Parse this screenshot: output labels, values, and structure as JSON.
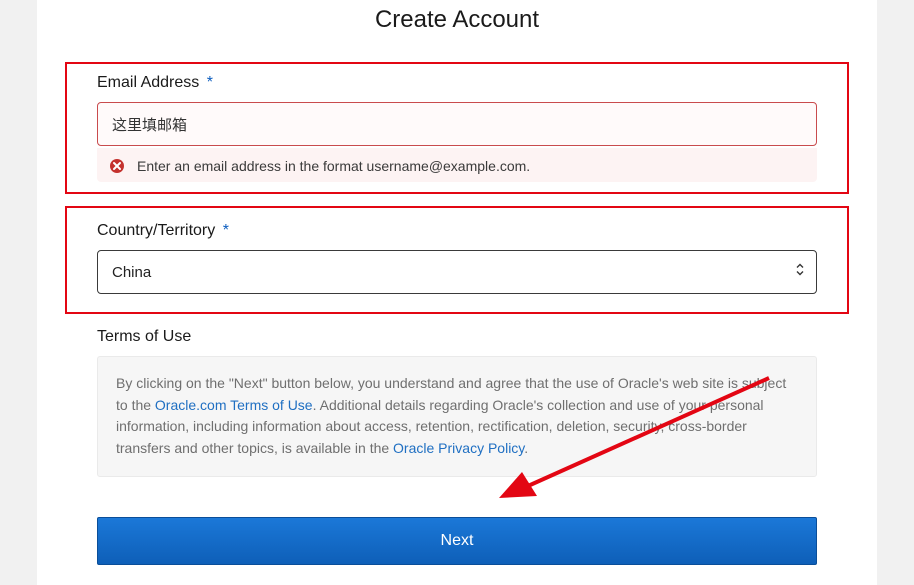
{
  "page_title": "Create Account",
  "email": {
    "label": "Email Address",
    "value": "这里填邮箱",
    "error": "Enter an email address in the format username@example.com."
  },
  "country": {
    "label": "Country/Territory",
    "value": "China"
  },
  "terms": {
    "heading": "Terms of Use",
    "pre": "By clicking on the \"Next\" button below, you understand and agree that the use of Oracle's web site is subject to the ",
    "link1": "Oracle.com Terms of Use",
    "mid": ". Additional details regarding Oracle's collection and use of your personal information, including information about access, retention, rectification, deletion, security, cross-border transfers and other topics, is available in the ",
    "link2": "Oracle Privacy Policy",
    "post": "."
  },
  "next_label": "Next",
  "required_mark": "*"
}
